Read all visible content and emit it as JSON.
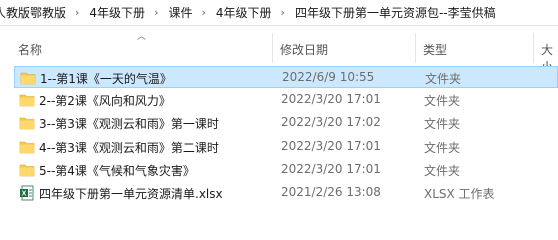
{
  "breadcrumb": [
    "人教版鄂教版",
    "4年级下册",
    "课件",
    "4年级下册",
    "四年级下册第一单元资源包--李莹供稿"
  ],
  "columns": {
    "name": "名称",
    "date": "修改日期",
    "type": "类型",
    "size": "大小"
  },
  "files": [
    {
      "name": "1--第1课《一天的气温》",
      "date": "2022/6/9 10:55",
      "type": "文件夹",
      "icon": "folder-icon",
      "selected": true
    },
    {
      "name": "2--第2课《风向和风力》",
      "date": "2022/3/20 17:01",
      "type": "文件夹",
      "icon": "folder-icon"
    },
    {
      "name": "3--第3课《观测云和雨》第一课时",
      "date": "2022/3/20 17:02",
      "type": "文件夹",
      "icon": "folder-icon"
    },
    {
      "name": "4--第3课《观测云和雨》第二课时",
      "date": "2022/3/20 17:01",
      "type": "文件夹",
      "icon": "folder-icon"
    },
    {
      "name": "5--第4课《气候和气象灾害》",
      "date": "2022/3/20 17:01",
      "type": "文件夹",
      "icon": "folder-icon"
    },
    {
      "name": "四年级下册第一单元资源清单.xlsx",
      "date": "2021/2/26 13:08",
      "type": "XLSX 工作表",
      "icon": "excel-file-icon"
    }
  ],
  "colors": {
    "selection_bg": "#cce8ff",
    "selection_border": "#99d1ff",
    "folder": "#f7c948",
    "excel": "#1d6f42"
  }
}
